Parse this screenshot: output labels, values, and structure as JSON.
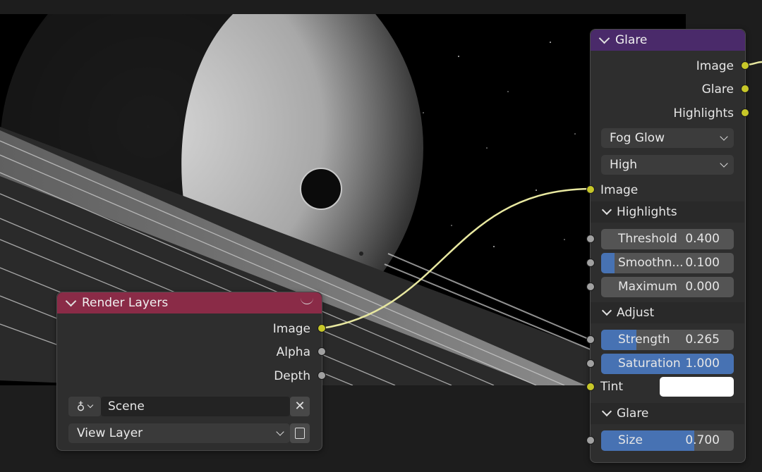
{
  "render_layers_node": {
    "title": "Render Layers",
    "outputs": [
      {
        "label": "Image",
        "socket_color": "#c7c729"
      },
      {
        "label": "Alpha",
        "socket_color": "#a1a1a1"
      },
      {
        "label": "Depth",
        "socket_color": "#a1a1a1"
      }
    ],
    "scene_field": "Scene",
    "view_layer_select": "View Layer",
    "header_color": "#8a2b47"
  },
  "glare_node": {
    "title": "Glare",
    "header_color": "#4a2a6a",
    "outputs": [
      "Image",
      "Glare",
      "Highlights"
    ],
    "glare_type_select": "Fog Glow",
    "quality_select": "High",
    "input_image_label": "Image",
    "highlights_section": {
      "title": "Highlights",
      "threshold": {
        "label": "Threshold",
        "value": "0.400",
        "fill": 0
      },
      "smoothness": {
        "label": "Smoothn...",
        "value": "0.100",
        "fill": 0.1
      },
      "maximum": {
        "label": "Maximum",
        "value": "0.000",
        "fill": 0
      }
    },
    "adjust_section": {
      "title": "Adjust",
      "strength": {
        "label": "Strength",
        "value": "0.265",
        "fill": 0.265
      },
      "saturation": {
        "label": "Saturation",
        "value": "1.000",
        "fill": 1.0
      },
      "tint_label": "Tint",
      "tint_color": "#ffffff"
    },
    "glare_section": {
      "title": "Glare",
      "size": {
        "label": "Size",
        "value": "0.700",
        "fill": 0.7
      }
    }
  },
  "colors": {
    "socket_yellow": "#c7c729",
    "socket_gray": "#a1a1a1",
    "slider_fill": "#4772b3",
    "link_color": "#e8e8a0"
  }
}
